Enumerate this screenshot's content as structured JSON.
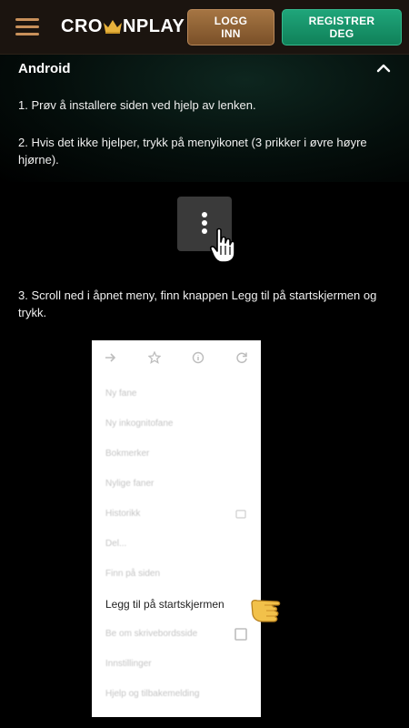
{
  "header": {
    "logo_left": "CRO",
    "logo_right": "NPLAY",
    "login_label_line1": "LOGG",
    "login_label_line2": "INN",
    "register_label_line1": "REGISTRER",
    "register_label_line2": "DEG"
  },
  "section": {
    "title": "Android"
  },
  "steps": [
    "1. Prøv å installere siden ved hjelp av lenken.",
    "2. Hvis det ikke hjelper, trykk på menyikonet (3 prikker i øvre høyre hjørne).",
    "3. Scroll ned i åpnet meny, finn knappen Legg til på startskjermen og trykk."
  ],
  "menu_screenshot": {
    "items": [
      "Ny fane",
      "Ny inkognitofane",
      "Bokmerker",
      "Nylige faner",
      "Historikk",
      "Del...",
      "Finn på siden",
      "Legg til på startskjermen",
      "Be om skrivebordsside",
      "Innstillinger",
      "Hjelp og tilbakemelding"
    ]
  },
  "colors": {
    "header_bg": "#1b140f",
    "login_button": "#8f6235",
    "register_button": "#189a6d",
    "menu_icon": "#c8905a",
    "crown": "#e8b23c"
  }
}
